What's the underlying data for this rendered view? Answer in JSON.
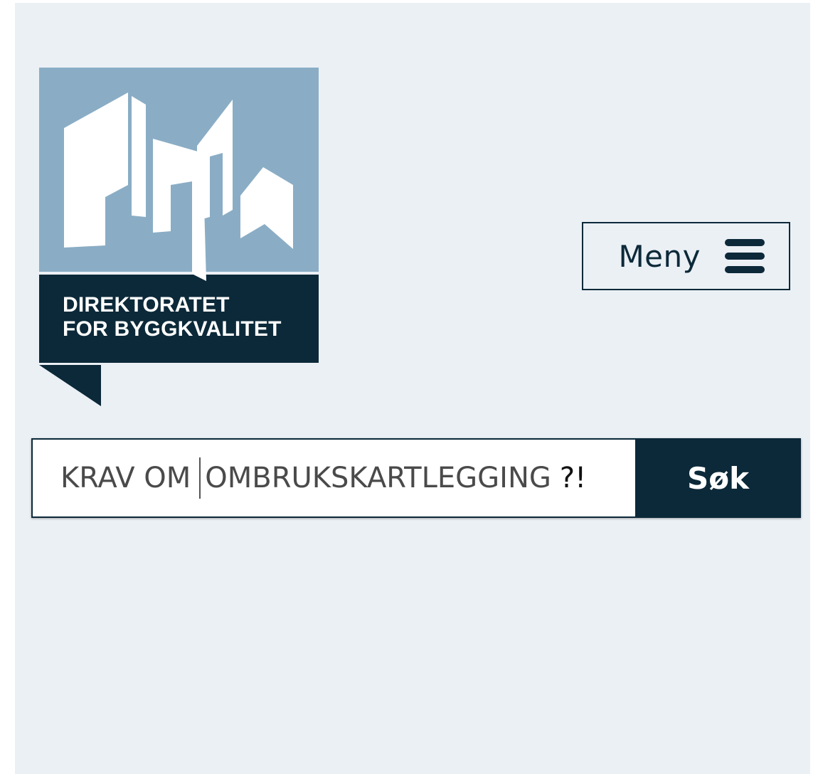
{
  "logo": {
    "line1": "DIREKTORATET",
    "line2": "FOR BYGGKVALITET",
    "colors": {
      "light": "#8aadc5",
      "dark": "#0c2939",
      "shapes": "#ffffff"
    }
  },
  "header": {
    "menu_label": "Meny",
    "menu_icon": "hamburger-icon"
  },
  "search": {
    "value_part1": "KRAV OM",
    "value_part2": "OMBRUKSKARTLEGGING",
    "value_suffix": "?!",
    "button_label": "Søk"
  },
  "colors": {
    "page_background": "#ebf0f5",
    "brand_dark": "#0c2939"
  }
}
